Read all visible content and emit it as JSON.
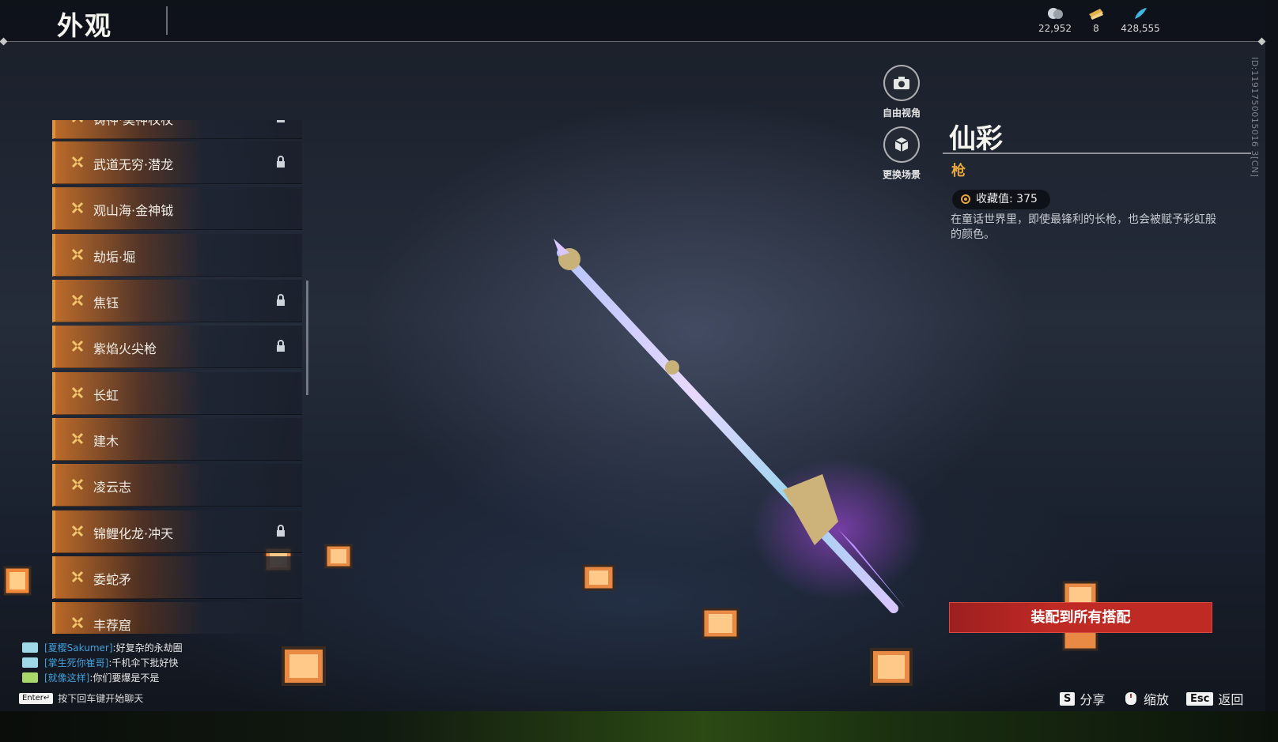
{
  "header": {
    "title": "外观",
    "currencies": [
      {
        "icon": "coin-icon",
        "value": "22,952"
      },
      {
        "icon": "ticket-icon",
        "value": "8"
      },
      {
        "icon": "feather-icon",
        "value": "428,555"
      }
    ],
    "vertical_id": "ID:1191750015016 3[CN]"
  },
  "list": {
    "items": [
      {
        "label": "铸神·莫神权杖",
        "locked": true
      },
      {
        "label": "武道无穷·潜龙",
        "locked": true
      },
      {
        "label": "观山海·金神钺",
        "locked": false
      },
      {
        "label": "劫垢·堀",
        "locked": false
      },
      {
        "label": "焦钰",
        "locked": true
      },
      {
        "label": "紫焰火尖枪",
        "locked": true
      },
      {
        "label": "长虹",
        "locked": false
      },
      {
        "label": "建木",
        "locked": false
      },
      {
        "label": "凌云志",
        "locked": false
      },
      {
        "label": "锦鲤化龙·冲天",
        "locked": true
      },
      {
        "label": "委蛇矛",
        "locked": false
      },
      {
        "label": "丰荐窟",
        "locked": false
      }
    ]
  },
  "side_buttons": {
    "free_view": "自由视角",
    "change_scene": "更换场景"
  },
  "detail": {
    "name": "仙彩",
    "type": "枪",
    "collection_label": "收藏值:",
    "collection_value": "375",
    "description": "在童话世界里，即使最锋利的长枪，也会被赋予彩虹般的颜色。"
  },
  "actions": {
    "equip_all": "装配到所有搭配",
    "share_key": "S",
    "share_label": "分享",
    "zoom_label": "缩放",
    "back_key": "Esc",
    "back_label": "返回"
  },
  "chat": {
    "lines": [
      {
        "name": "[夏樱Sakumer]",
        "text": ":好复杂的永劫圈"
      },
      {
        "name": "[掌生死你崔哥]",
        "text": ":千机伞下批好快"
      },
      {
        "name": "[就像这样]",
        "text": ":你们要爆是不是"
      }
    ],
    "enter_key": "Enter↵",
    "enter_hint": "按下回车键开始聊天"
  },
  "colors": {
    "accent_orange": "#e0933f",
    "type_gold": "#e8a63c",
    "equip_red": "#c02a25",
    "chat_name_blue": "#3ea0dc"
  }
}
